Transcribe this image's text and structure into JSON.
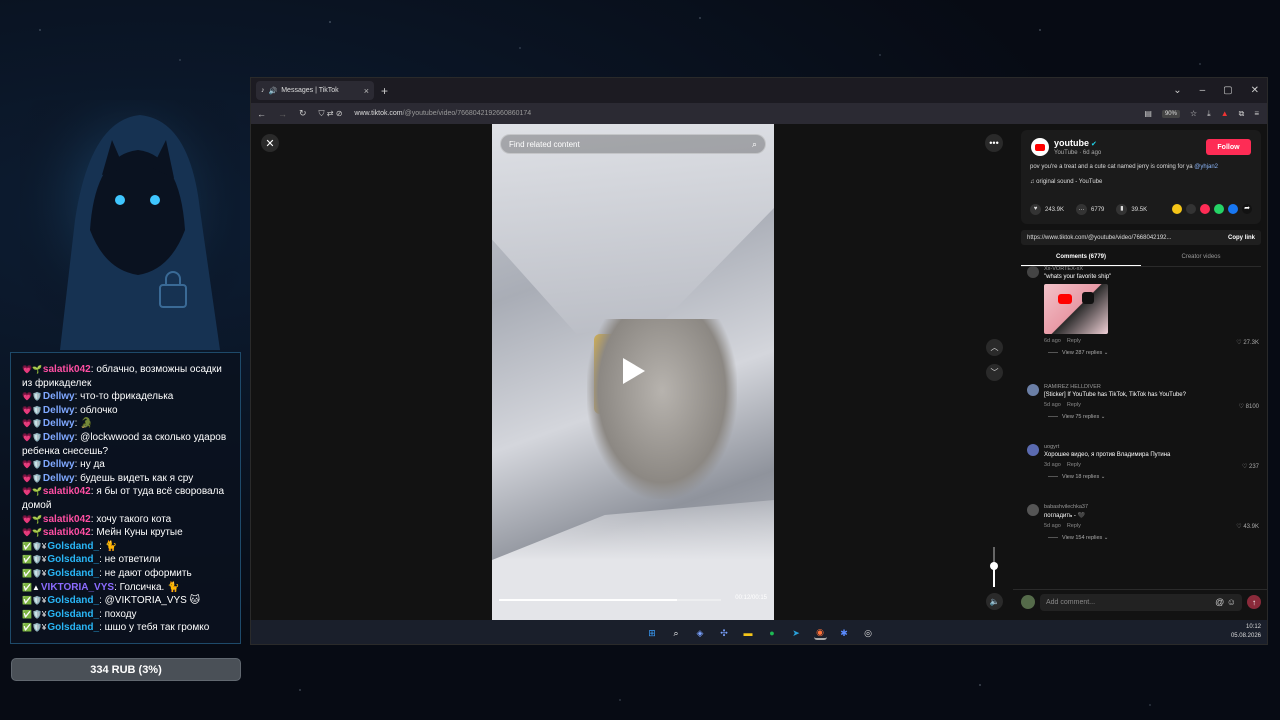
{
  "chat": {
    "lines": [
      {
        "badges": "💗🌱",
        "nick": "salatik042",
        "color": "#ff4fa3",
        "text": "облачно, возможны осадки из фрикаделек"
      },
      {
        "badges": "💗🛡️",
        "nick": "Dellwy",
        "color": "#7fa8ff",
        "text": "что-то фрикаделька"
      },
      {
        "badges": "💗🛡️",
        "nick": "Dellwy",
        "color": "#7fa8ff",
        "text": "облочко"
      },
      {
        "badges": "💗🛡️",
        "nick": "Dellwy",
        "color": "#7fa8ff",
        "text": "🐊"
      },
      {
        "badges": "💗🛡️",
        "nick": "Dellwy",
        "color": "#7fa8ff",
        "text": "@lockwwood за сколько ударов ребенка снесешь?"
      },
      {
        "badges": "💗🛡️",
        "nick": "Dellwy",
        "color": "#7fa8ff",
        "text": "ну да"
      },
      {
        "badges": "💗🛡️",
        "nick": "Dellwy",
        "color": "#7fa8ff",
        "text": "будешь видеть как я сру"
      },
      {
        "badges": "💗🌱",
        "nick": "salatik042",
        "color": "#ff4fa3",
        "text": "я бы от туда всё своровала домой"
      },
      {
        "badges": "💗🌱",
        "nick": "salatik042",
        "color": "#ff4fa3",
        "text": "хочу такого кота"
      },
      {
        "badges": "💗🌱",
        "nick": "salatik042",
        "color": "#ff4fa3",
        "text": "Мейн Куны крутые"
      },
      {
        "badges": "✅🛡️¥",
        "nick": "Golsdand_",
        "color": "#29b6f6",
        "text": "🐈"
      },
      {
        "badges": "✅🛡️¥",
        "nick": "Golsdand_",
        "color": "#29b6f6",
        "text": "не ответили"
      },
      {
        "badges": "✅🛡️¥",
        "nick": "Golsdand_",
        "color": "#29b6f6",
        "text": "не дают оформить"
      },
      {
        "badges": "✅▲",
        "nick": "VIKTORIA_VYS",
        "color": "#8b6bff",
        "text": "Голсичка. 🐈"
      },
      {
        "badges": "✅🛡️¥",
        "nick": "Golsdand_",
        "color": "#29b6f6",
        "text": "@VIKTORIA_VYS 🐱"
      },
      {
        "badges": "✅🛡️¥",
        "nick": "Golsdand_",
        "color": "#29b6f6",
        "text": "походу"
      },
      {
        "badges": "✅🛡️¥",
        "nick": "Golsdand_",
        "color": "#29b6f6",
        "text": "шшо у тебя так громко"
      }
    ]
  },
  "donation": {
    "label": "334 RUB (3%)",
    "progress_percent": 3
  },
  "browser": {
    "tab_title": "Messages | TikTok",
    "url_host": "www.tiktok.com",
    "url_path": "/@youtube/video/7668042192660860174",
    "zoom": "90%"
  },
  "video": {
    "search_placeholder": "Find related content",
    "time": "00:12/00:15",
    "progress_fraction": 0.8,
    "volume_fraction": 0.5
  },
  "post": {
    "username": "youtube",
    "subline": "YouTube · 6d ago",
    "follow_label": "Follow",
    "description": "pov you're a treat and a cute cat named jerry is coming for ya",
    "mention": "@yhjan2",
    "sound": "original sound - YouTube",
    "likes": "243.9K",
    "comments": "6779",
    "saves": "39.5K",
    "link": "https://www.tiktok.com/@youtube/video/7668042192...",
    "copy_label": "Copy link",
    "tab_comments": "Comments (6779)",
    "tab_creator": "Creator videos"
  },
  "comments": [
    {
      "user": "Xx-VORTEX-xX",
      "text": "\"whats your favorite ship\"",
      "time": "6d ago",
      "reply": "Reply",
      "likes": "27.3K",
      "replies": "View 287 replies",
      "has_image": true,
      "avatar": "#444"
    },
    {
      "user": "RAMIREZ HELLDIVER",
      "text": "[Sticker] If YouTube has TikTok, TikTok has YouTube?",
      "time": "5d ago",
      "reply": "Reply",
      "likes": "8100",
      "replies": "View 75 replies",
      "has_image": false,
      "avatar": "#6b7fa6"
    },
    {
      "user": "uogyrt",
      "text": "Хорошее видео, я против Владимира Путина",
      "time": "3d ago",
      "reply": "Reply",
      "likes": "237",
      "replies": "View 18 replies",
      "has_image": false,
      "avatar": "#5a6ab0"
    },
    {
      "user": "babashvilechka37",
      "text": "погладить - 🖤",
      "time": "5d ago",
      "reply": "Reply",
      "likes": "43.9K",
      "replies": "View 154 replies",
      "has_image": false,
      "avatar": "#555"
    }
  ],
  "add_comment_placeholder": "Add comment...",
  "clock": {
    "time": "10:12",
    "date": "05.08.2026"
  },
  "colors": {
    "accent": "#fe2c55",
    "panel_border": "#1e4a6a"
  }
}
